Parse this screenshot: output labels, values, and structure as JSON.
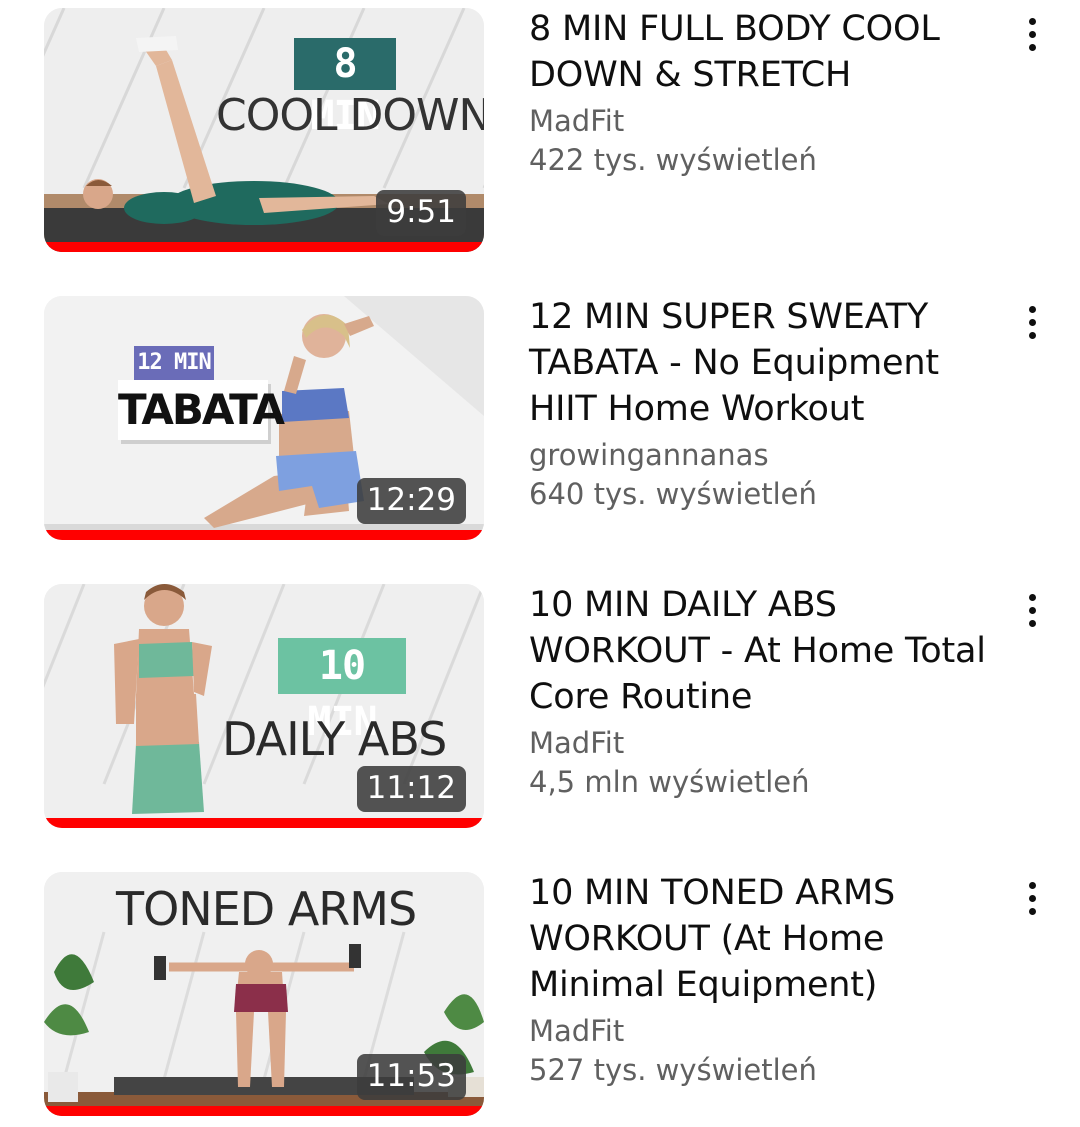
{
  "videos": [
    {
      "title": "8 MIN FULL BODY COOL DOWN & STRETCH",
      "channel": "MadFit",
      "views": "422 tys. wyświetleń",
      "duration": "9:51",
      "watched_fraction": 1.0,
      "thumbnail": {
        "badge": "8 MIN",
        "caption": "COOL DOWN",
        "badge_color": "#2a6b6a"
      }
    },
    {
      "title": "12 MIN SUPER SWEATY TABATA - No Equipment HIIT Home Workout",
      "channel": "growingannanas",
      "views": "640 tys. wyświetleń",
      "duration": "12:29",
      "watched_fraction": 1.0,
      "thumbnail": {
        "badge": "12 MIN",
        "caption": "TABATA",
        "badge_color": "#6a6cb8"
      }
    },
    {
      "title": "10 MIN DAILY ABS WORKOUT - At Home Total Core Routine",
      "channel": "MadFit",
      "views": "4,5 mln wyświetleń",
      "duration": "11:12",
      "watched_fraction": 1.0,
      "thumbnail": {
        "badge": "10 MIN",
        "caption": "DAILY ABS",
        "badge_color": "#6cc2a2"
      }
    },
    {
      "title": "10 MIN TONED ARMS WORKOUT (At Home Minimal Equipment)",
      "channel": "MadFit",
      "views": "527 tys. wyświetleń",
      "duration": "11:53",
      "watched_fraction": 1.0,
      "thumbnail": {
        "caption": "TONED ARMS"
      }
    }
  ],
  "colors": {
    "progress": "#ff0000",
    "title_text": "#0f0f0f",
    "secondary_text": "#606060"
  },
  "icons": {
    "menu": "more-vert-icon"
  }
}
